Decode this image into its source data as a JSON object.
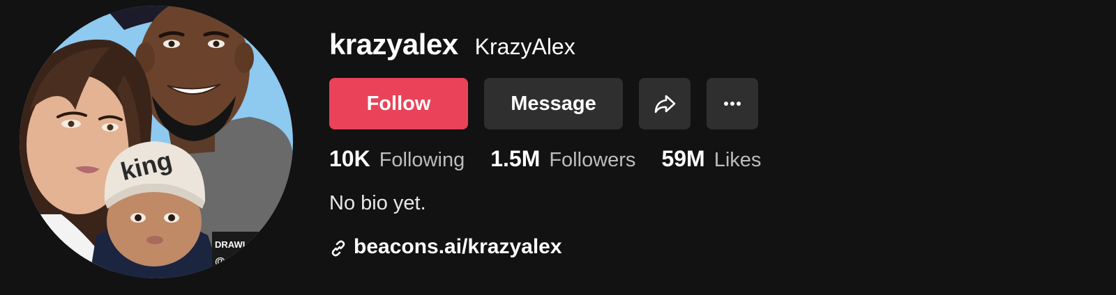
{
  "profile": {
    "username": "krazyalex",
    "nickname": "KrazyAlex",
    "bio": "No bio yet.",
    "link": "beacons.ai/krazyalex",
    "avatar_alt": "profile-avatar"
  },
  "buttons": {
    "follow": "Follow",
    "message": "Message",
    "share_icon": "share-icon",
    "more_icon": "more-icon"
  },
  "stats": [
    {
      "value": "10K",
      "label": "Following"
    },
    {
      "value": "1.5M",
      "label": "Followers"
    },
    {
      "value": "59M",
      "label": "Likes"
    }
  ],
  "avatar_overlay": {
    "line1": "DRAWI",
    "line2": "@ K"
  },
  "colors": {
    "background": "#121212",
    "follow": "#ea4359",
    "secondary_button": "#2f2f2f",
    "muted_text": "#bdbdbd",
    "avatar_sky": "#8ec9f0"
  }
}
